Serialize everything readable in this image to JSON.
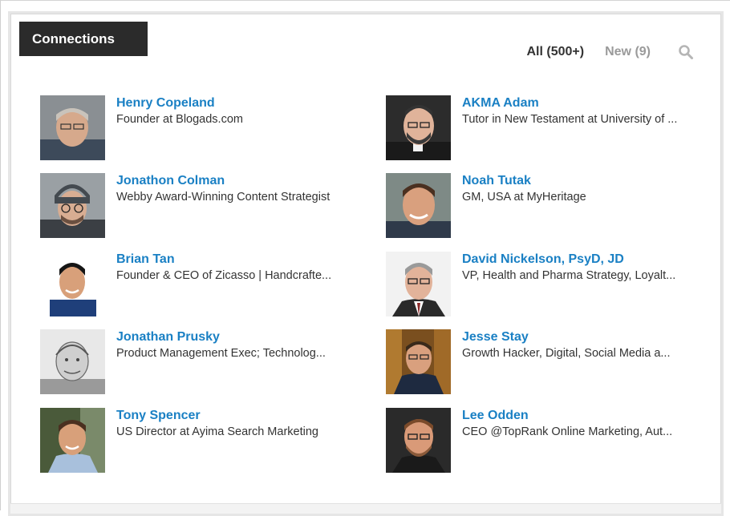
{
  "header": {
    "title": "Connections"
  },
  "filters": {
    "all_label": "All (500+)",
    "new_label": "New (9)",
    "search_icon": "search-icon"
  },
  "connections": [
    {
      "name": "Henry Copeland",
      "headline": "Founder at Blogads.com"
    },
    {
      "name": "AKMA Adam",
      "headline": "Tutor in New Testament at University of ..."
    },
    {
      "name": "Jonathon Colman",
      "headline": "Webby Award-Winning Content Strategist"
    },
    {
      "name": "Noah Tutak",
      "headline": "GM, USA at MyHeritage"
    },
    {
      "name": "Brian Tan",
      "headline": "Founder & CEO of Zicasso | Handcrafte..."
    },
    {
      "name": "David Nickelson, PsyD, JD",
      "headline": "VP, Health and Pharma Strategy, Loyalt..."
    },
    {
      "name": "Jonathan Prusky",
      "headline": "Product Management Exec; Technolog..."
    },
    {
      "name": "Jesse Stay",
      "headline": "Growth Hacker, Digital, Social Media a..."
    },
    {
      "name": "Tony Spencer",
      "headline": "US Director at Ayima Search Marketing"
    },
    {
      "name": "Lee Odden",
      "headline": "CEO @TopRank Online Marketing, Aut..."
    }
  ],
  "colors": {
    "link": "#1a80c4",
    "header_bg": "#2b2b2b",
    "text": "#333333",
    "muted": "#9a9a9a"
  }
}
